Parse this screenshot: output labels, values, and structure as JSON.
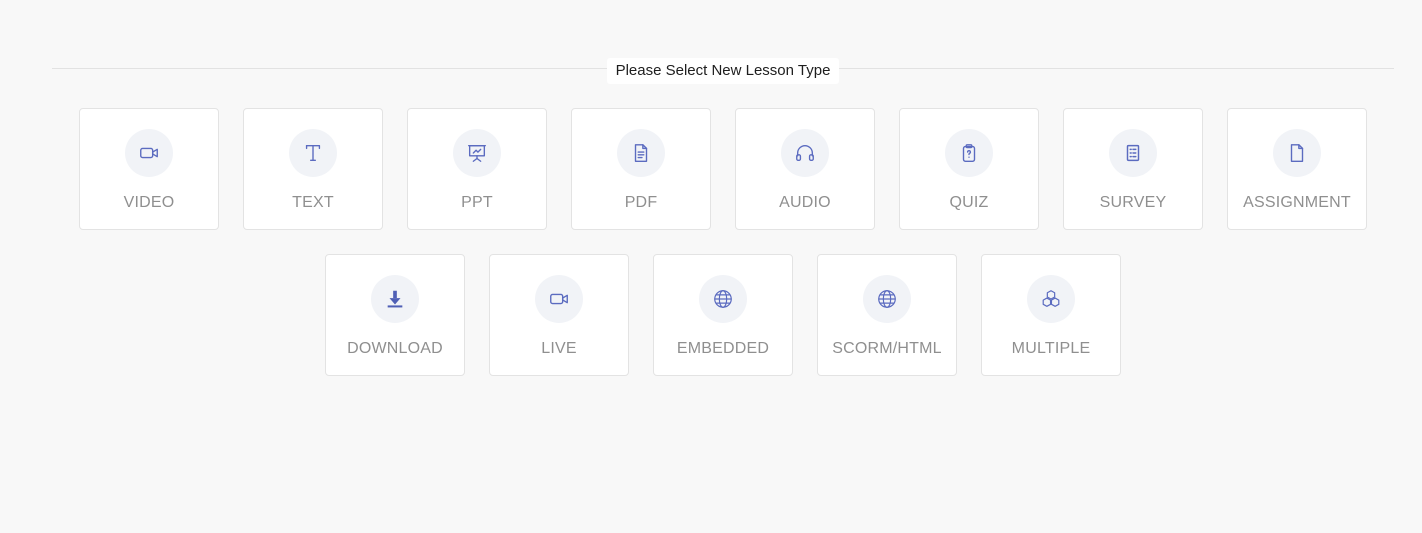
{
  "heading": "Please Select New Lesson Type",
  "accent_color": "#5b6bc0",
  "lesson_types": [
    {
      "label": "VIDEO",
      "icon": "video-camera-icon"
    },
    {
      "label": "TEXT",
      "icon": "text-icon"
    },
    {
      "label": "PPT",
      "icon": "presentation-icon"
    },
    {
      "label": "PDF",
      "icon": "document-icon"
    },
    {
      "label": "AUDIO",
      "icon": "headphones-icon"
    },
    {
      "label": "QUIZ",
      "icon": "clipboard-question-icon"
    },
    {
      "label": "SURVEY",
      "icon": "survey-checklist-icon"
    },
    {
      "label": "ASSIGNMENT",
      "icon": "file-icon"
    },
    {
      "label": "DOWNLOAD",
      "icon": "download-icon"
    },
    {
      "label": "LIVE",
      "icon": "video-camera-icon"
    },
    {
      "label": "EMBEDDED",
      "icon": "globe-icon"
    },
    {
      "label": "SCORM/HTML",
      "icon": "globe-icon"
    },
    {
      "label": "MULTIPLE",
      "icon": "cubes-icon"
    }
  ]
}
